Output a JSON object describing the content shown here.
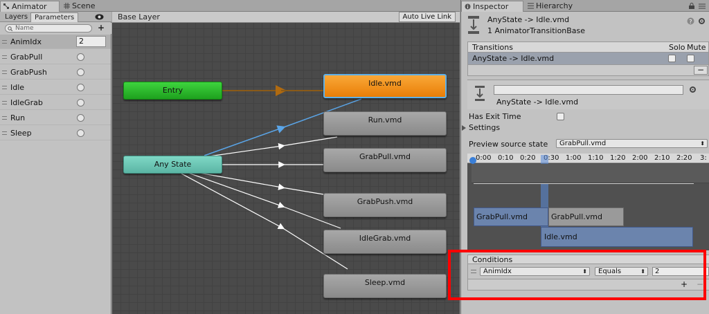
{
  "tabs": {
    "animator": "Animator",
    "scene": "Scene",
    "inspector": "Inspector",
    "hierarchy": "Hierarchy"
  },
  "left_panel": {
    "subtabs": [
      "Layers",
      "Parameters"
    ],
    "search_placeholder": "Name",
    "add_label": "+",
    "parameters": [
      {
        "name": "AnimIdx",
        "type": "int",
        "value": "2"
      },
      {
        "name": "GrabPull",
        "type": "trigger"
      },
      {
        "name": "GrabPush",
        "type": "trigger"
      },
      {
        "name": "Idle",
        "type": "trigger"
      },
      {
        "name": "IdleGrab",
        "type": "trigger"
      },
      {
        "name": "Run",
        "type": "trigger"
      },
      {
        "name": "Sleep",
        "type": "trigger"
      }
    ]
  },
  "graph": {
    "breadcrumb": "Base Layer",
    "auto_live_link": "Auto Live Link",
    "nodes": {
      "entry": "Entry",
      "any_state": "Any State",
      "idle": "Idle.vmd",
      "run": "Run.vmd",
      "grab_pull": "GrabPull.vmd",
      "grab_push": "GrabPush.vmd",
      "idle_grab": "IdleGrab.vmd",
      "sleep": "Sleep.vmd"
    },
    "colors": {
      "entry": "#2fbf2f",
      "any_state": "#6ec8b6",
      "default_state": "#f39215",
      "selected_transition": "#5aa5e8"
    }
  },
  "inspector": {
    "header_title": "AnyState -> Idle.vmd",
    "header_subtitle": "1 AnimatorTransitionBase",
    "transitions_label": "Transitions",
    "solo_label": "Solo",
    "mute_label": "Mute",
    "transition_row": "AnyState -> Idle.vmd",
    "remove_label": "−",
    "transition_name": "AnyState -> Idle.vmd",
    "has_exit_time_label": "Has Exit Time",
    "settings_label": "Settings",
    "preview_source_label": "Preview source state",
    "preview_source_value": "GrabPull.vmd",
    "timeline_ticks": [
      "0:00",
      "0:10",
      "0:20",
      "0:30",
      "1:00",
      "1:10",
      "1:20",
      "2:00",
      "2:10",
      "2:20",
      "3:"
    ],
    "timeline_clips": {
      "clip1": "GrabPull.vmd",
      "clip2": "GrabPull.vmd",
      "clip3": "Idle.vmd"
    },
    "conditions_label": "Conditions",
    "condition": {
      "parameter": "AnimIdx",
      "operator": "Equals",
      "value": "2"
    },
    "add_condition": "+",
    "remove_condition": "−"
  }
}
